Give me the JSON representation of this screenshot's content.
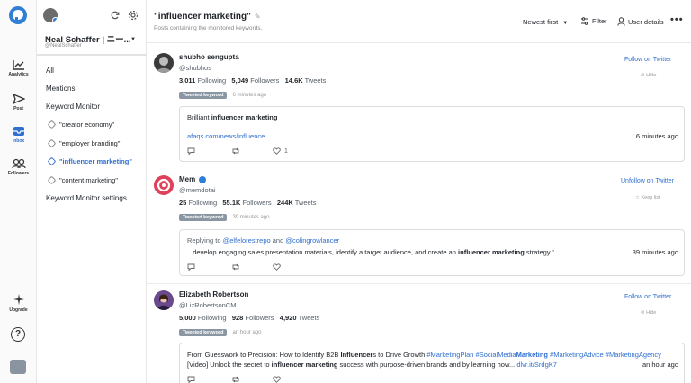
{
  "rail": {
    "items": [
      {
        "label": "Analytics",
        "icon": "chart-line-icon"
      },
      {
        "label": "Post",
        "icon": "send-icon"
      },
      {
        "label": "Inbox",
        "icon": "inbox-icon"
      },
      {
        "label": "Followers",
        "icon": "users-icon"
      },
      {
        "label": "Upgrade",
        "icon": "sparkle-icon"
      }
    ],
    "help": "?"
  },
  "account": {
    "name": "Neal Schaffer | ニー...",
    "handle": "@NealSchaffer"
  },
  "sidebar": {
    "all": "All",
    "mentions": "Mentions",
    "keyword_monitor": "Keyword Monitor",
    "keywords": [
      {
        "label": "\"creator economy\"",
        "active": false
      },
      {
        "label": "\"employer branding\"",
        "active": false
      },
      {
        "label": "\"influencer marketing\"",
        "active": true
      },
      {
        "label": "\"content marketing\"",
        "active": false
      }
    ],
    "settings": "Keyword Monitor settings"
  },
  "header": {
    "title": "\"influencer marketing\"",
    "subtitle": "Posts containing the monitored keywords.",
    "sort": "Newest first",
    "filter": "Filter",
    "user_details": "User details",
    "more": "•••"
  },
  "posts": [
    {
      "name": "shubho sengupta",
      "handle": "@shubhos",
      "following": "3,011",
      "following_label": "Following",
      "followers": "5,049",
      "followers_label": "Followers",
      "tweets": "14.6K",
      "tweets_label": "Tweets",
      "tag": "Tweeted keyword",
      "tag_ago": "6 minutes ago",
      "follow": "Follow on Twitter",
      "hide": "Hide",
      "body_pre": "Brilliant ",
      "body_bold": "influencer marketing",
      "link": "afaqs.com/news/influence...",
      "time": "6 minutes ago",
      "likes": "1"
    },
    {
      "name": "Mem",
      "handle": "@memdotai",
      "following": "25",
      "following_label": "Following",
      "followers": "55.1K",
      "followers_label": "Followers",
      "tweets": "244K",
      "tweets_label": "Tweets",
      "tag": "Tweeted keyword",
      "tag_ago": "39 minutes ago",
      "follow": "Unfollow on Twitter",
      "hide": "Keep list",
      "reply_prefix": "Replying to ",
      "reply_user1": "@elfelorestrepo",
      "reply_and": " and ",
      "reply_user2": "@colingrowlancer",
      "body_pre": "...develop engaging sales presentation materials, identify a target audience, and create an ",
      "body_bold": "influencer marketing",
      "body_post": " strategy.\"",
      "time": "39 minutes ago"
    },
    {
      "name": "Elizabeth Robertson",
      "handle": "@LizRobertsonCM",
      "following": "5,000",
      "following_label": "Following",
      "followers": "928",
      "followers_label": "Followers",
      "tweets": "4,920",
      "tweets_label": "Tweets",
      "tag": "Tweeted keyword",
      "tag_ago": "an hour ago",
      "follow": "Follow on Twitter",
      "hide": "Hide",
      "line1_pre": "From Guesswork to Precision: How to Identify B2B ",
      "line1_bold": "Influencer",
      "line1_mid": "s to Drive Growth ",
      "line1_tag1": "#Marketing",
      "line1_tag1b": "Plan",
      "line1_tag2": " #SocialMedia",
      "line1_tag2b": "Marketing",
      "line1_tag3": " #Marketing",
      "line1_tag3b": "Advice",
      "line1_tag4": " #Marketing",
      "line1_tag4b": "Agency",
      "line2_pre": "[Video] Unlock the secret to ",
      "line2_bold": "influencer marketing",
      "line2_post": " success with purpose-driven brands and by learning how... ",
      "line2_link": "dlvr.it/SrdgK7",
      "time": "an hour ago"
    }
  ],
  "colors": {
    "accent": "#2f6fd0",
    "chip": "#8b96a3",
    "logo": "#2f7fd6"
  }
}
